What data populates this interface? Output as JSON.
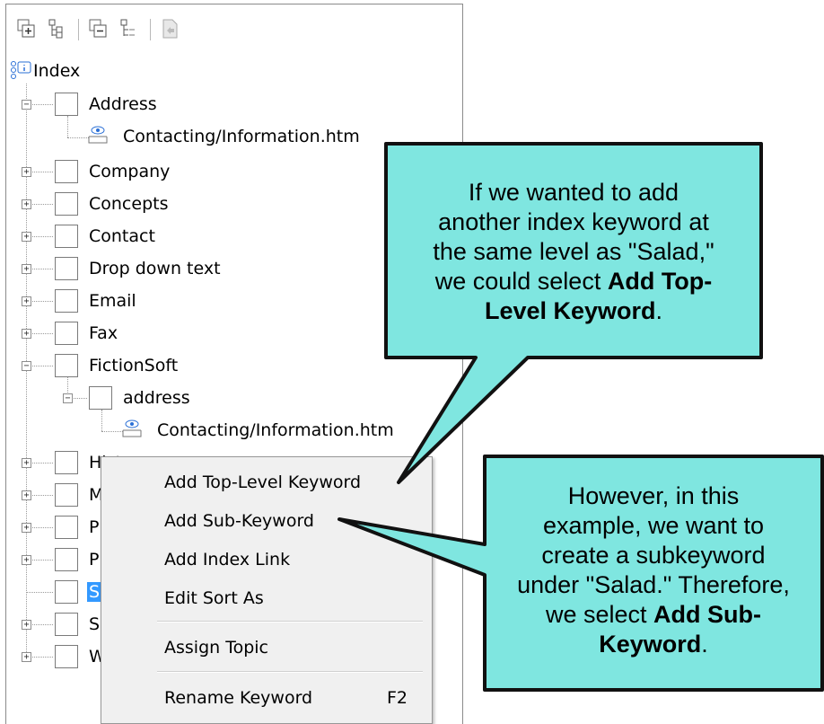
{
  "toolbar": {
    "icons": [
      "add-keyword-icon",
      "add-subkeyword-icon",
      "remove-keyword-icon",
      "collapse-tree-icon",
      "assign-topic-icon"
    ]
  },
  "tree": {
    "root_label": "Index",
    "items": [
      {
        "label": "Address",
        "expander": "−"
      },
      {
        "label": "Contacting/Information.htm"
      },
      {
        "label": "Company",
        "expander": "+"
      },
      {
        "label": "Concepts",
        "expander": "+"
      },
      {
        "label": "Contact",
        "expander": "+"
      },
      {
        "label": "Drop down text",
        "expander": "+"
      },
      {
        "label": "Email",
        "expander": "+"
      },
      {
        "label": "Fax",
        "expander": "+"
      },
      {
        "label": "FictionSoft",
        "expander": "−"
      },
      {
        "label": "address",
        "expander": "−"
      },
      {
        "label": "Contacting/Information.htm"
      },
      {
        "label": "History",
        "expander": "+"
      },
      {
        "label": "M",
        "expander": "+"
      },
      {
        "label": "P",
        "expander": "+"
      },
      {
        "label": "P",
        "expander": "+"
      },
      {
        "label": "S"
      },
      {
        "label": "S",
        "expander": "+"
      },
      {
        "label": "W",
        "expander": "+"
      }
    ]
  },
  "context_menu": {
    "items": [
      {
        "label": "Add Top-Level Keyword"
      },
      {
        "label": "Add Sub-Keyword"
      },
      {
        "label": "Add Index Link"
      },
      {
        "label": "Edit Sort As"
      },
      {
        "label": "Assign Topic"
      },
      {
        "label": "Rename Keyword",
        "shortcut": "F2"
      }
    ]
  },
  "callouts": {
    "top": {
      "line1": "If we wanted to add",
      "line2": "another index keyword at",
      "line3": "the same level as \"Salad,\"",
      "line4_pre": "we could select ",
      "line4_bold": "Add Top-",
      "line5_bold": "Level Keyword",
      "line5_post": "."
    },
    "bottom": {
      "line1": "However, in this",
      "line2": "example, we want to",
      "line3": "create a subkeyword",
      "line4": "under \"Salad.\" Therefore,",
      "line5_pre": "we select ",
      "line5_bold": "Add Sub-",
      "line6_bold": "Keyword",
      "line6_post": "."
    }
  },
  "colors": {
    "callout_fill": "#7fe6e0",
    "callout_border": "#111111",
    "selection": "#3399ff",
    "menu_bg": "#f0f0f0"
  }
}
